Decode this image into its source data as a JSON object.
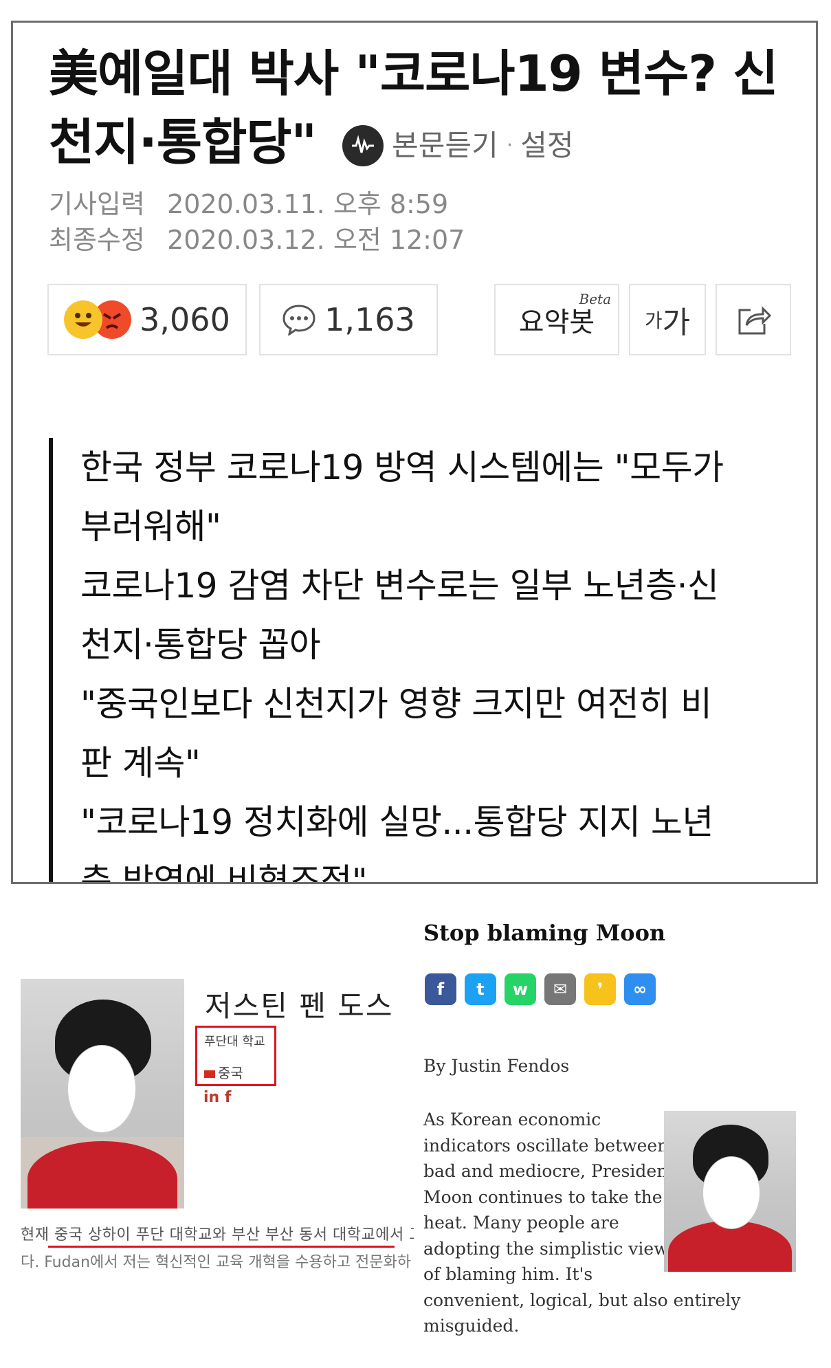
{
  "article": {
    "headline_line1": "美예일대 박사 \"코로나19 변수? 신",
    "headline_line2": "천지·통합당\"",
    "listen_label": "본문듣기",
    "listen_separator": "·",
    "listen_settings": "설정",
    "meta": {
      "input_label": "기사입력",
      "input_value": "2020.03.11. 오후 8:59",
      "modified_label": "최종수정",
      "modified_value": "2020.03.12. 오전 12:07"
    },
    "reactions_count": "3,060",
    "comments_count": "1,163",
    "summary_bot_label": "요약봇",
    "summary_bot_badge": "Beta",
    "font_size_label_small": "가",
    "font_size_label_large": "가",
    "summary_lines": [
      "한국 정부 코로나19 방역 시스템에는 \"모두가",
      "부러워해\"",
      "코로나19 감염 차단 변수로는 일부 노년층·신",
      "천지·통합당 꼽아",
      "\"중국인보다 신천지가 영향 크지만 여전히 비",
      "판 계속\"",
      "\"코로나19 정치화에 실망...통합당 지지 노년",
      "층 방역에 비협조적\""
    ]
  },
  "profile": {
    "name": "저스틴 펜 도스",
    "university": "푸단대 학교",
    "country": "중국",
    "social_links": "in f",
    "bio_line1": "현재 중국 상하이 푸단 대학교와 부산 부산 동서 대학교에서 고",
    "bio_line2": "다. Fudan에서 저는 혁신적인 교육 개혁을 수용하고 전문화하"
  },
  "oped": {
    "title": "Stop blaming Moon",
    "byline": "By Justin Fendos",
    "body_lines": [
      "As Korean economic",
      "indicators oscillate between",
      "bad and mediocre, President",
      "Moon continues to take the",
      "heat. Many people are",
      "adopting the simplistic view",
      "of blaming him. It's",
      "convenient, logical, but also entirely",
      "misguided."
    ],
    "share_icons": [
      {
        "name": "facebook-icon",
        "glyph": "f",
        "color": "#3b5998"
      },
      {
        "name": "twitter-icon",
        "glyph": "t",
        "color": "#1da1f2"
      },
      {
        "name": "whatsapp-icon",
        "glyph": "w",
        "color": "#25d366"
      },
      {
        "name": "email-icon",
        "glyph": "✉",
        "color": "#777777"
      },
      {
        "name": "kakaotalk-icon",
        "glyph": "❜",
        "color": "#f7c21b"
      },
      {
        "name": "link-icon",
        "glyph": "∞",
        "color": "#2e8ff0"
      }
    ]
  },
  "colors": {
    "highlight_red": "#e0141e",
    "border_gray": "#6d6d6d"
  }
}
